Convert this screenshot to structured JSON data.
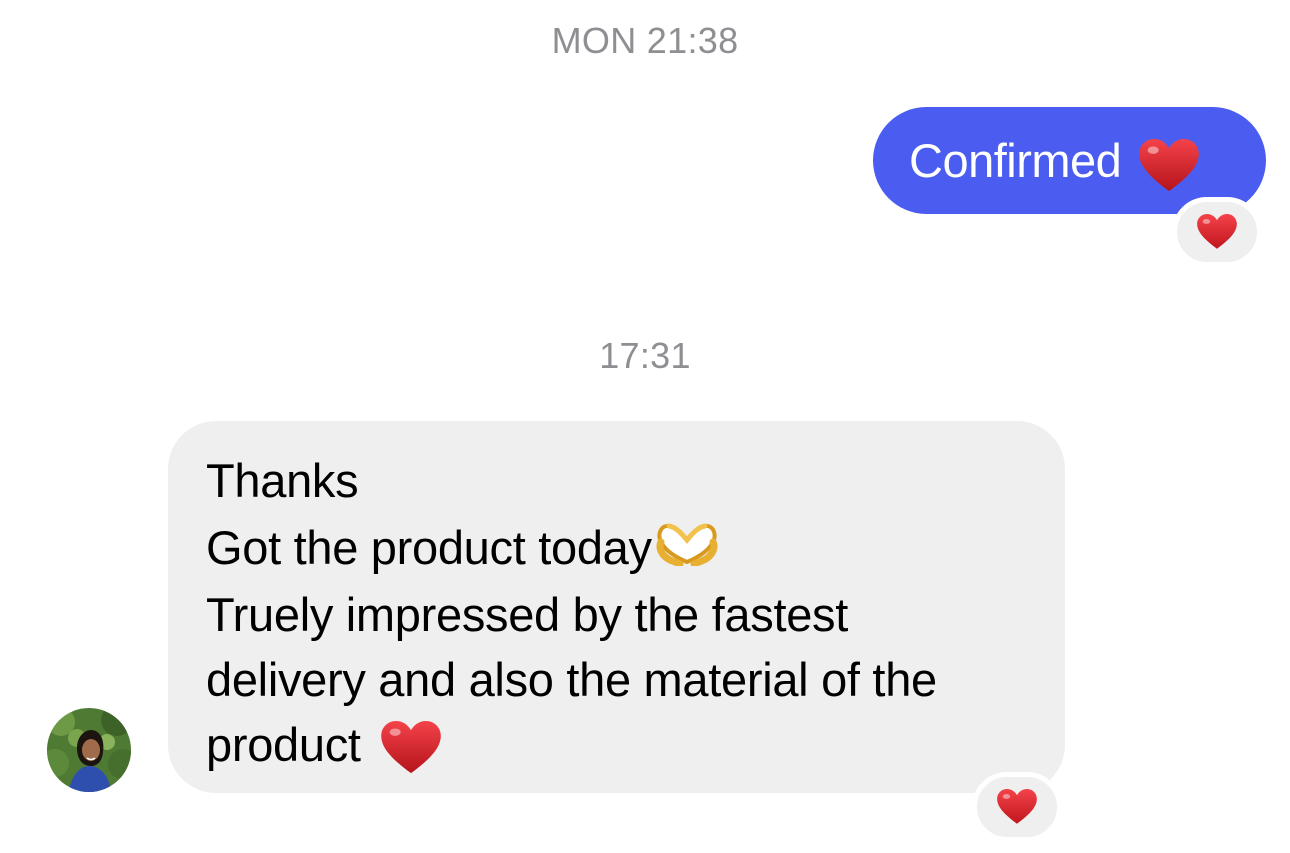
{
  "conversation": {
    "timestamp_1": "MON 21:38",
    "timestamp_2": "17:31"
  },
  "outgoing_message": {
    "text": "Confirmed",
    "inline_icon": "red-heart-icon",
    "bubble_color": "#4a5df0",
    "reaction": "red-heart-icon"
  },
  "incoming_message": {
    "lines": [
      "Thanks",
      "Got the product today",
      "Truely impressed by the fastest",
      "delivery and also the material of the",
      "product"
    ],
    "inline_icons": [
      "heart-hands-icon",
      "red-heart-icon"
    ],
    "bubble_color": "#efefef",
    "reaction": "red-heart-icon"
  },
  "sender": {
    "avatar": "profile-photo-avatar"
  },
  "colors": {
    "timestamp": "#8e8e93",
    "heart": "#e0242b"
  }
}
